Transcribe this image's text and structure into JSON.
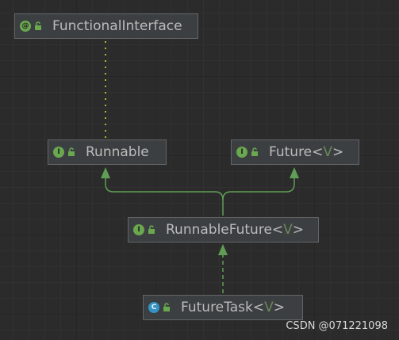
{
  "diagram": {
    "nodes": {
      "functional_interface": {
        "icon": "@",
        "name": "FunctionalInterface"
      },
      "runnable": {
        "icon": "I",
        "name": "Runnable"
      },
      "future": {
        "icon": "I",
        "name": "Future<",
        "type_param": "V",
        "suffix": ">"
      },
      "runnable_future": {
        "icon": "I",
        "name": "RunnableFuture<",
        "type_param": "V",
        "suffix": ">"
      },
      "future_task": {
        "icon": "C",
        "name": "FutureTask<",
        "type_param": "V",
        "suffix": ">"
      }
    },
    "colors": {
      "background": "#2b2b2b",
      "node_fill": "#3c3f41",
      "node_border": "#646464",
      "text": "#bbbbbb",
      "type_param": "#6a8759",
      "edge": "#5f9e55",
      "annotation_edge": "#a8b832",
      "class_icon": "#3592c4",
      "interface_icon": "#6aa84f"
    }
  },
  "watermark": "CSDN @071221098"
}
